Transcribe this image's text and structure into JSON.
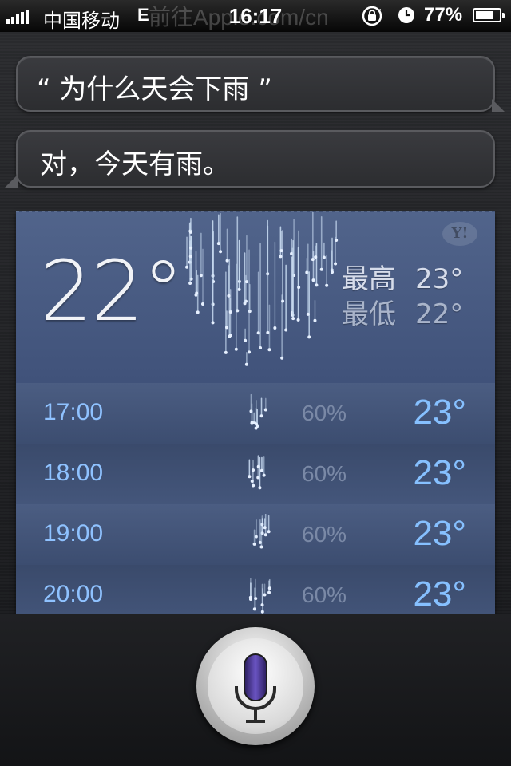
{
  "status_bar": {
    "carrier": "中国移动",
    "network": "E",
    "time": "16:17",
    "watermark": "前往Apple.com/cn",
    "battery_percent_text": "77%",
    "battery_level": 0.77,
    "signal_bars": 5
  },
  "conversation": {
    "user_query": "“ 为什么天会下雨 ”",
    "siri_response": "对，今天有雨。"
  },
  "weather": {
    "provider_icon": "yahoo-logo-icon",
    "current_temp": "22°",
    "condition_icon": "rain-icon",
    "high_label": "最高",
    "high_value": "23°",
    "low_label": "最低",
    "low_value": "22°",
    "hourly": [
      {
        "time": "17:00",
        "precip": "60%",
        "temp": "23°"
      },
      {
        "time": "18:00",
        "precip": "60%",
        "temp": "23°"
      },
      {
        "time": "19:00",
        "precip": "60%",
        "temp": "23°"
      },
      {
        "time": "20:00",
        "precip": "60%",
        "temp": "23°"
      }
    ]
  },
  "siri": {
    "mic_icon": "microphone-icon"
  },
  "colors": {
    "card_blue": "#4c5f84",
    "hour_time": "#8fc2ff",
    "hour_temp": "#86c0ff"
  }
}
